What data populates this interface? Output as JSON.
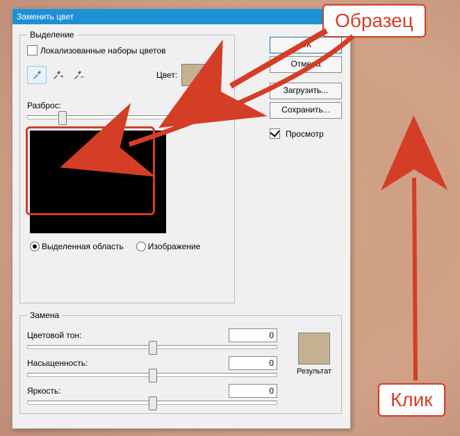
{
  "dialog": {
    "title": "Заменить цвет",
    "selection_group": "Выделение",
    "localized_colors": "Локализованные наборы цветов",
    "color_label": "Цвет:",
    "swatch_color": "#c4b192",
    "fuzziness_label": "Разброс:",
    "fuzziness_value": "34",
    "radio_selection": "Выделенная область",
    "radio_image": "Изображение"
  },
  "buttons": {
    "ok": "ОК",
    "cancel": "Отмена",
    "load": "Загрузить...",
    "save": "Сохранить..."
  },
  "preview_checkbox": "Просмотр",
  "replacement": {
    "group": "Замена",
    "hue": "Цветовой тон:",
    "saturation": "Насыщенность:",
    "lightness": "Яркость:",
    "result_label": "Результат",
    "result_color": "#c4b192",
    "hue_val": "0",
    "sat_val": "0",
    "light_val": "0"
  },
  "annotations": {
    "sample": "Образец",
    "click": "Клик"
  }
}
